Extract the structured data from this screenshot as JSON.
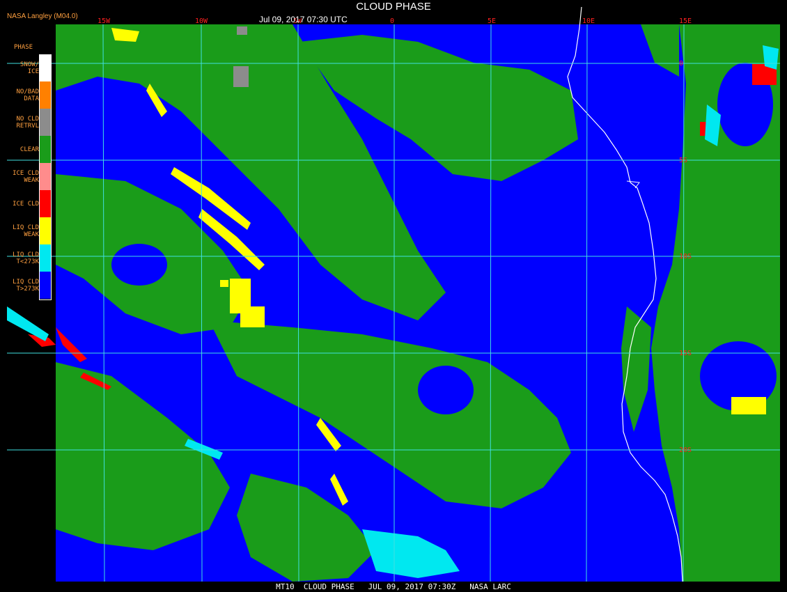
{
  "header": {
    "provider": "NASA Langley (M04.0)",
    "title": "CLOUD PHASE",
    "datetime": "Jul 09, 2017 07:30 UTC"
  },
  "legend": {
    "title": "PHASE",
    "items": [
      {
        "label": "SNOW/\nICE",
        "color": "#ffffff"
      },
      {
        "label": "NO/BAD\nDATA",
        "color": "#ff8000"
      },
      {
        "label": "NO CLD\nRETRVL",
        "color": "#8c8c8c"
      },
      {
        "label": "CLEAR",
        "color": "#1a9c1a"
      },
      {
        "label": "ICE CLD\nWEAK",
        "color": "#ff8c8c"
      },
      {
        "label": "ICE CLD",
        "color": "#ff0000"
      },
      {
        "label": "LIQ CLD\nWEAK",
        "color": "#ffff00"
      },
      {
        "label": "LIQ CLD\nT<273K",
        "color": "#00e8f0"
      },
      {
        "label": "LIQ CLD\nT>273K",
        "color": "#0000ff"
      }
    ]
  },
  "grid": {
    "longitudes": [
      "15W",
      "10W",
      "5W",
      "0",
      "5E",
      "10E",
      "15E"
    ],
    "latitudes": [
      "0",
      "5S",
      "10S",
      "15S",
      "20S"
    ]
  },
  "footer": "MT10  CLOUD PHASE   JUL 09, 2017 07:30Z   NASA LARC",
  "colors": {
    "ocean_liquid": "#0000ff",
    "clear": "#1a9c1a",
    "grid": "#40e0e0",
    "coast": "#ffffff",
    "label": "#ffa040",
    "gridlabel": "#ff2020"
  }
}
